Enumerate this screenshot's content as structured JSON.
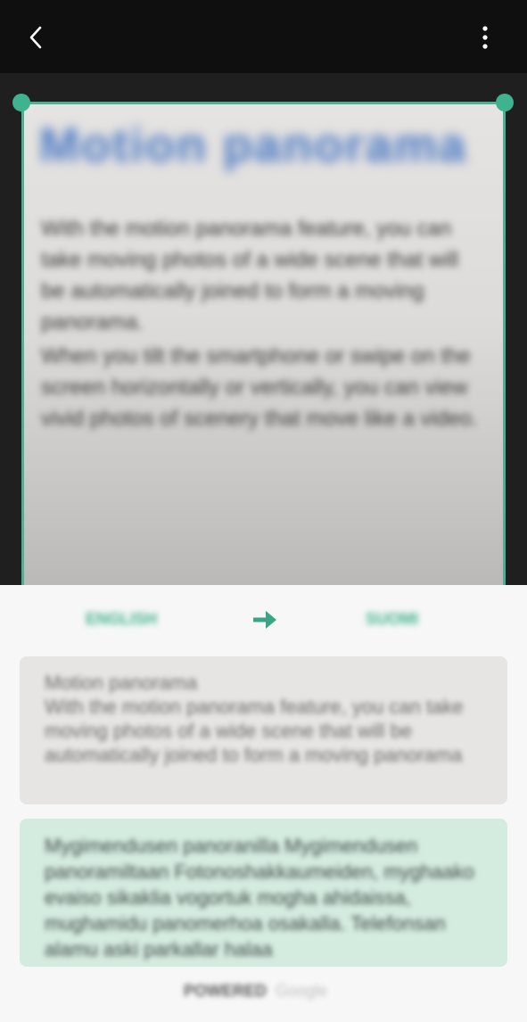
{
  "appbar": {
    "back_icon": "back-arrow-icon",
    "more_icon": "more-vert-icon"
  },
  "document": {
    "title": "Motion panorama",
    "paragraph1": "With the motion panorama feature, you can take moving photos of a wide scene that will be automatically joined to form a moving panorama.",
    "paragraph2": "When you tilt the smartphone or swipe on the screen horizontally or vertically, you can view vivid photos of scenery that move like a video."
  },
  "translation": {
    "source_language": "ENGLISH",
    "target_language": "SUOMI",
    "swap_icon": "arrow-right-icon",
    "source_text": "Motion panorama\nWith the motion panorama feature, you can take moving photos of a wide scene that will be automatically joined to form a moving panorama",
    "translated_text": "Mygimendusen panoranilla Mygimendusen panoramiltaan Fotonoshakkaumeiden, myghaako evaiso sikaklia vogortuk mogha ahidaissa, mughamidu panomerhoa osakalla. Telefonsan alamu aski parkallar halaa",
    "powered_by": "POWERED",
    "powered_brand": "Google"
  },
  "colors": {
    "accent": "#45b48f",
    "appbar_bg": "#0f0f0f",
    "source_card": "#e6e5e4",
    "target_card": "#d4ebe0"
  }
}
